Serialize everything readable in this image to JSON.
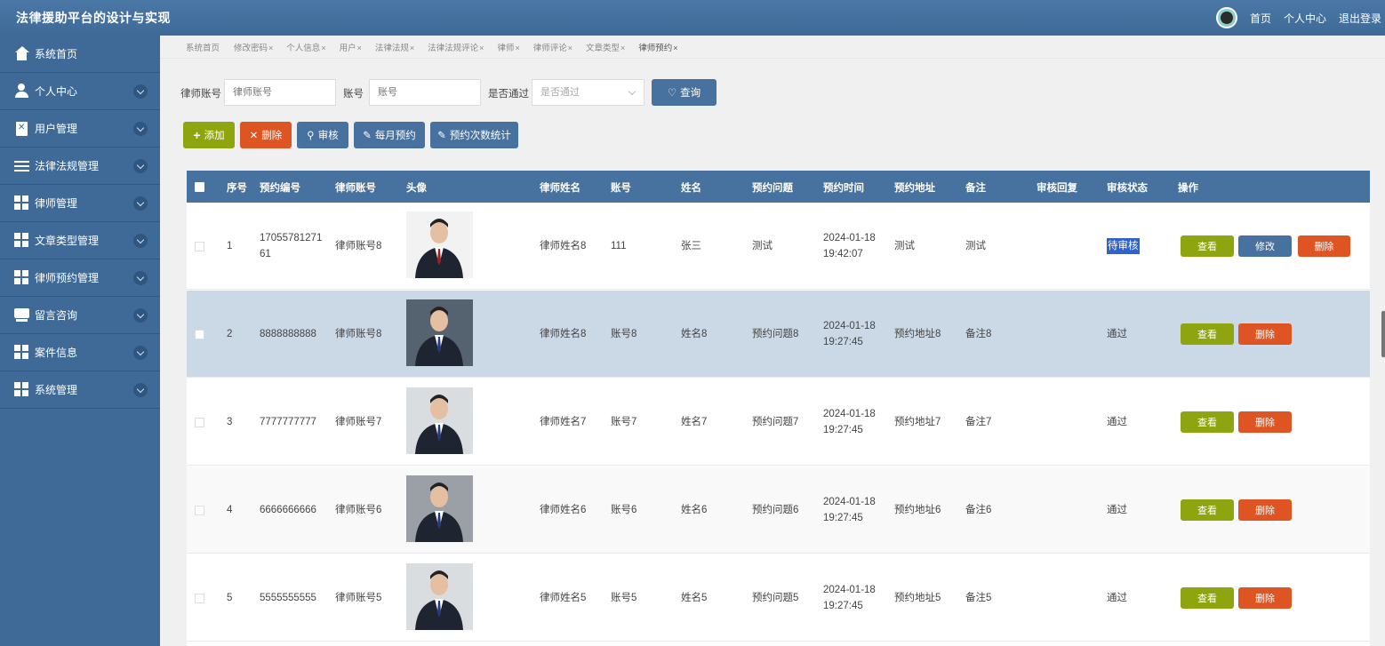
{
  "app": {
    "title": "法律援助平台的设计与实现",
    "header_links": [
      "首页",
      "个人中心",
      "退出登录"
    ]
  },
  "sidebar": {
    "items": [
      {
        "label": "系统首页",
        "icon": "home-icon"
      },
      {
        "label": "个人中心",
        "icon": "user-icon"
      },
      {
        "label": "用户管理",
        "icon": "clipboard-icon"
      },
      {
        "label": "法律法规管理",
        "icon": "list-icon"
      },
      {
        "label": "律师管理",
        "icon": "grid-icon"
      },
      {
        "label": "文章类型管理",
        "icon": "grid-icon"
      },
      {
        "label": "律师预约管理",
        "icon": "grid-icon"
      },
      {
        "label": "留言咨询",
        "icon": "chat-icon"
      },
      {
        "label": "案件信息",
        "icon": "grid-icon"
      },
      {
        "label": "系统管理",
        "icon": "grid-icon"
      }
    ]
  },
  "tabs": [
    {
      "label": "系统首页",
      "close": ""
    },
    {
      "label": "修改密码",
      "close": "×"
    },
    {
      "label": "个人信息",
      "close": "×"
    },
    {
      "label": "用户",
      "close": "×"
    },
    {
      "label": "法律法规",
      "close": "×"
    },
    {
      "label": "法律法规评论",
      "close": "×"
    },
    {
      "label": "律师",
      "close": "×"
    },
    {
      "label": "律师评论",
      "close": "×"
    },
    {
      "label": "文章类型",
      "close": "×"
    },
    {
      "label": "律师预约",
      "close": "×"
    }
  ],
  "search": {
    "lawyer_account_label": "律师账号",
    "lawyer_account_placeholder": "律师账号",
    "account_label": "账号",
    "account_placeholder": "账号",
    "passed_label": "是否通过",
    "passed_placeholder": "是否通过",
    "query_button": "查询"
  },
  "toolbar": {
    "add": "添加",
    "delete": "删除",
    "review": "审核",
    "monthly": "每月预约",
    "stats": "预约次数统计"
  },
  "table": {
    "headers": [
      "序号",
      "预约编号",
      "律师账号",
      "头像",
      "律师姓名",
      "账号",
      "姓名",
      "预约问题",
      "预约时间",
      "预约地址",
      "备注",
      "审核回复",
      "审核状态",
      "操作"
    ],
    "actions": {
      "view": "查看",
      "edit": "修改",
      "delete": "删除"
    },
    "rows": [
      {
        "no": "1",
        "code": "17055781271",
        "code2": "61",
        "lawyer_account": "律师账号8",
        "lawyer_name": "律师姓名8",
        "account": "111",
        "name": "张三",
        "question": "测试",
        "date": "2024-01-18",
        "time": "19:42:07",
        "address": "测试",
        "remark": "测试",
        "reply": "",
        "status": "待审核"
      },
      {
        "no": "2",
        "code": "8888888888",
        "code2": "",
        "lawyer_account": "律师账号8",
        "lawyer_name": "律师姓名8",
        "account": "账号8",
        "name": "姓名8",
        "question": "预约问题8",
        "date": "2024-01-18",
        "time": "19:27:45",
        "address": "预约地址8",
        "remark": "备注8",
        "reply": "",
        "status": "通过"
      },
      {
        "no": "3",
        "code": "7777777777",
        "code2": "",
        "lawyer_account": "律师账号7",
        "lawyer_name": "律师姓名7",
        "account": "账号7",
        "name": "姓名7",
        "question": "预约问题7",
        "date": "2024-01-18",
        "time": "19:27:45",
        "address": "预约地址7",
        "remark": "备注7",
        "reply": "",
        "status": "通过"
      },
      {
        "no": "4",
        "code": "6666666666",
        "code2": "",
        "lawyer_account": "律师账号6",
        "lawyer_name": "律师姓名6",
        "account": "账号6",
        "name": "姓名6",
        "question": "预约问题6",
        "date": "2024-01-18",
        "time": "19:27:45",
        "address": "预约地址6",
        "remark": "备注6",
        "reply": "",
        "status": "通过"
      },
      {
        "no": "5",
        "code": "5555555555",
        "code2": "",
        "lawyer_account": "律师账号5",
        "lawyer_name": "律师姓名5",
        "account": "账号5",
        "name": "姓名5",
        "question": "预约问题5",
        "date": "2024-01-18",
        "time": "19:27:45",
        "address": "预约地址5",
        "remark": "备注5",
        "reply": "",
        "status": "通过"
      }
    ]
  },
  "colors": {
    "header": "#47719f",
    "sidebar": "#3f6a98",
    "green": "#8ea50f",
    "red": "#df5423"
  }
}
